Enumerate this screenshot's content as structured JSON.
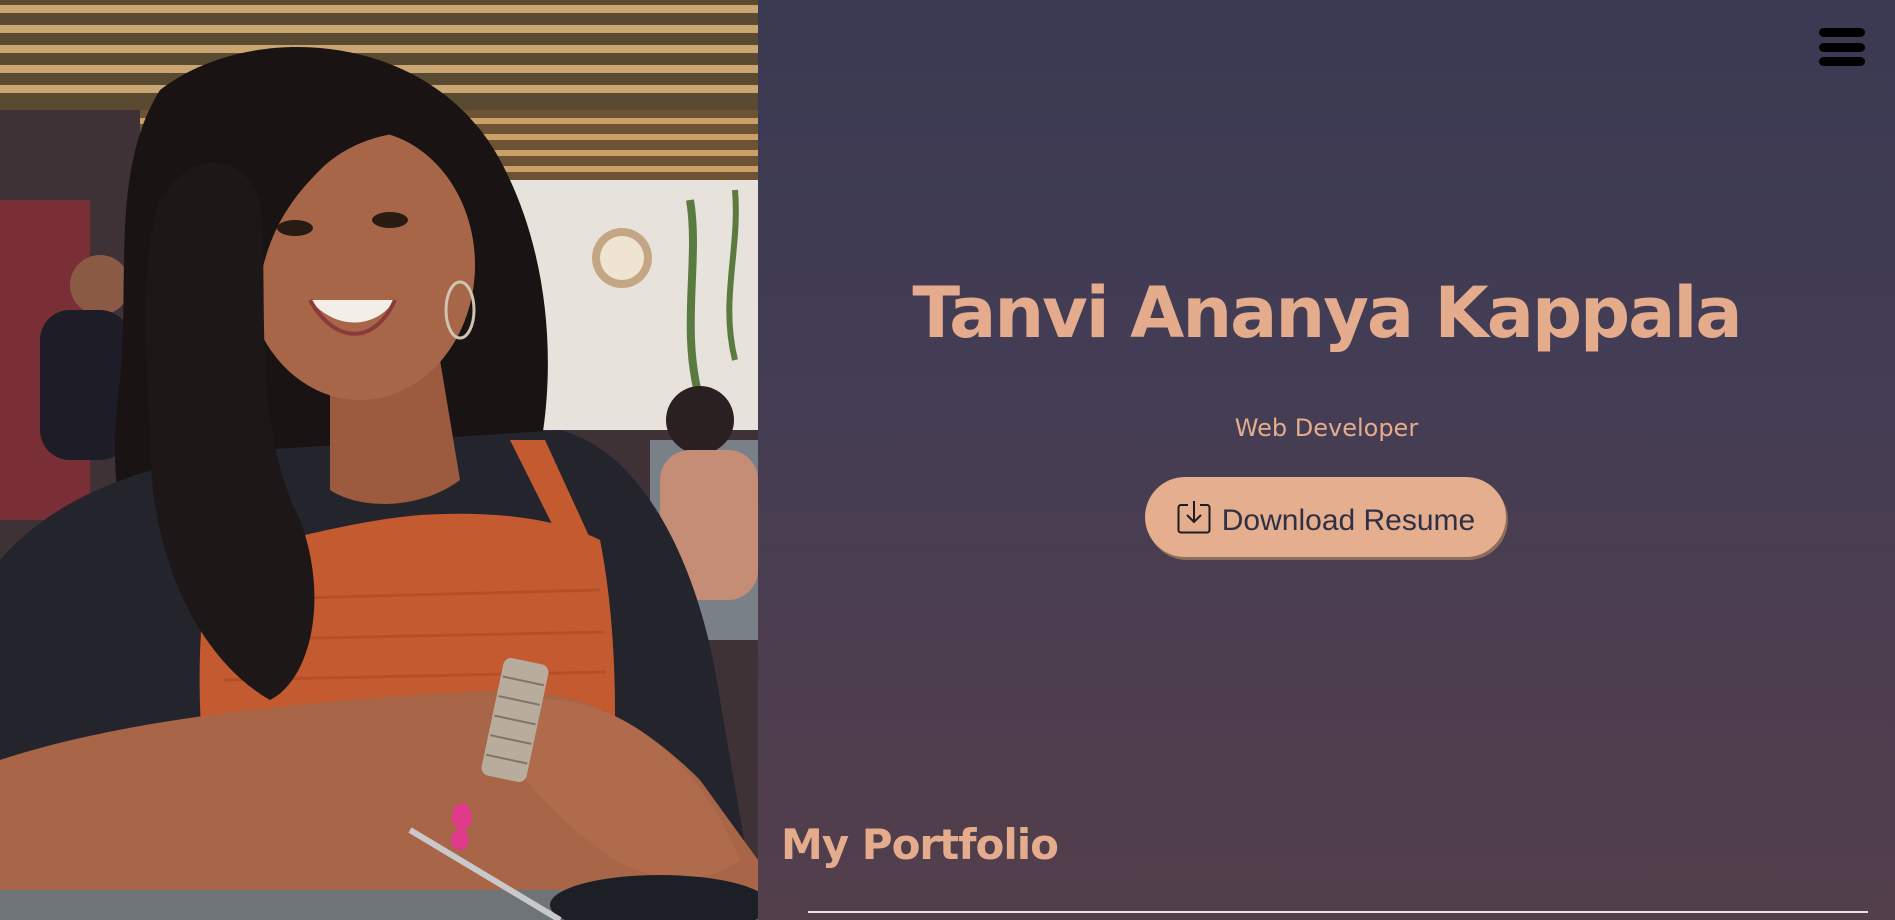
{
  "photo": {
    "alt": "Portrait photo",
    "colors": {
      "top": "#f4e7c5",
      "shirt": "#c3582f",
      "skin": "#a76548",
      "hair": "#1a1414"
    }
  },
  "menu": {
    "icon": "hamburger-menu-icon"
  },
  "hero": {
    "name": "Tanvi Ananya Kappala",
    "role": "Web Developer",
    "download_button": {
      "label": "Download Resume",
      "icon": "download-icon"
    }
  },
  "portfolio": {
    "heading": "My Portfolio"
  },
  "colors": {
    "accent": "#e4ac8c",
    "background_top": "#3a3a52",
    "background_bottom": "#533f4c",
    "button_text": "#2f3046"
  }
}
